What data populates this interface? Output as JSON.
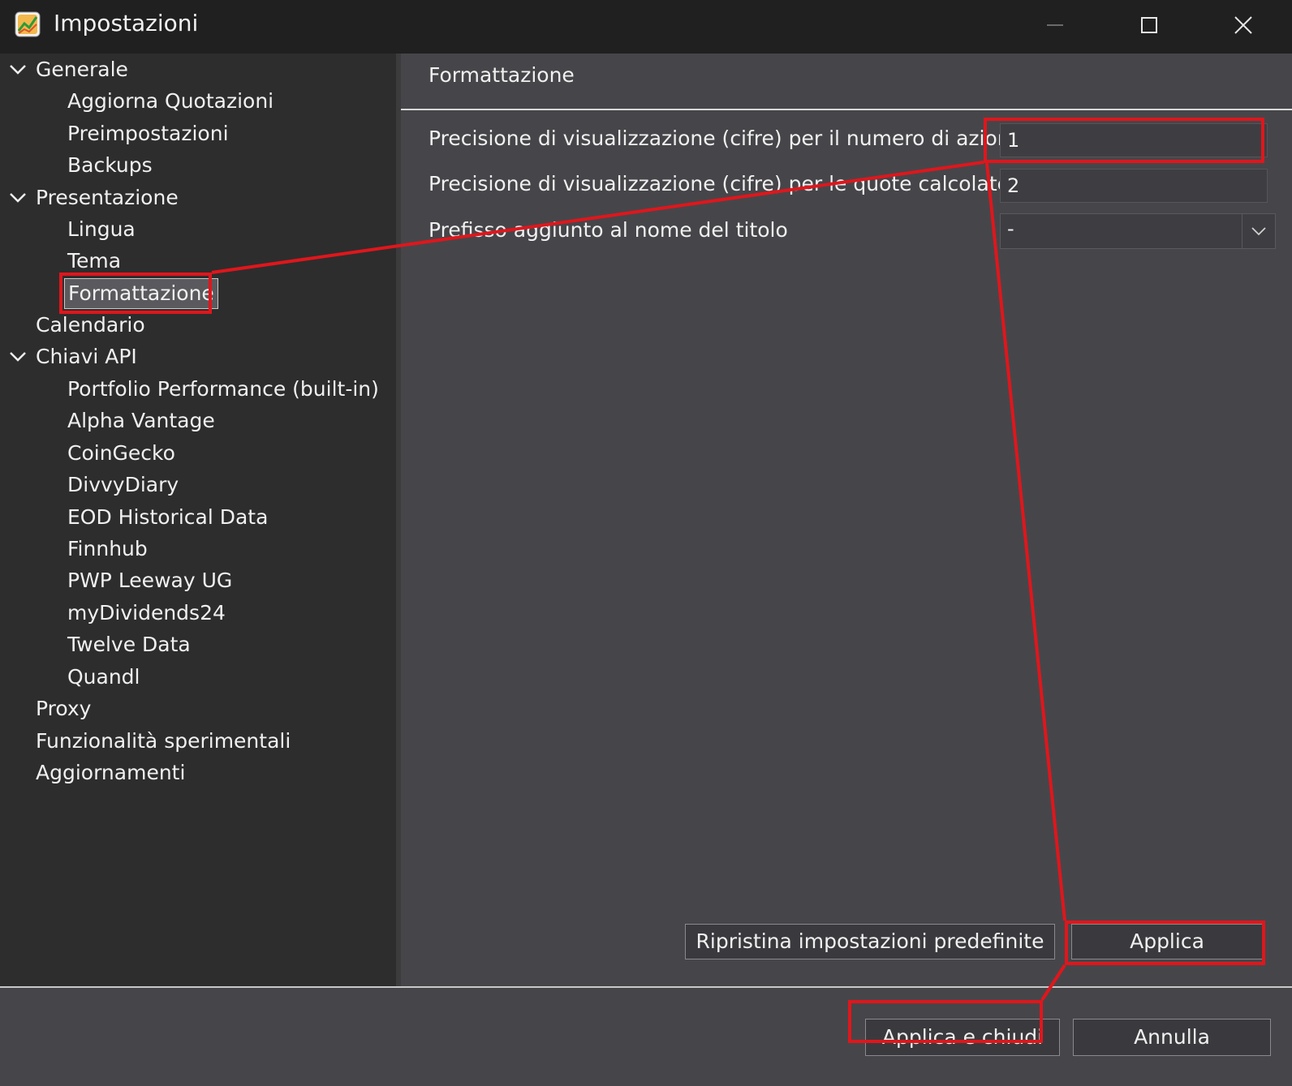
{
  "window": {
    "title": "Impostazioni",
    "icon": "chart-app-icon"
  },
  "sidebar": {
    "items": [
      {
        "label": "Generale",
        "level": 0,
        "expanded": true
      },
      {
        "label": "Aggiorna Quotazioni",
        "level": 1
      },
      {
        "label": "Preimpostazioni",
        "level": 1
      },
      {
        "label": "Backups",
        "level": 1
      },
      {
        "label": "Presentazione",
        "level": 0,
        "expanded": true
      },
      {
        "label": "Lingua",
        "level": 1
      },
      {
        "label": "Tema",
        "level": 1
      },
      {
        "label": "Formattazione",
        "level": 1,
        "selected": true
      },
      {
        "label": "Calendario",
        "level": 0
      },
      {
        "label": "Chiavi API",
        "level": 0,
        "expanded": true
      },
      {
        "label": "Portfolio Performance (built-in)",
        "level": 1
      },
      {
        "label": "Alpha Vantage",
        "level": 1
      },
      {
        "label": "CoinGecko",
        "level": 1
      },
      {
        "label": "DivvyDiary",
        "level": 1
      },
      {
        "label": "EOD Historical Data",
        "level": 1
      },
      {
        "label": "Finnhub",
        "level": 1
      },
      {
        "label": "PWP Leeway UG",
        "level": 1
      },
      {
        "label": "myDividends24",
        "level": 1
      },
      {
        "label": "Twelve Data",
        "level": 1
      },
      {
        "label": "Quandl",
        "level": 1
      },
      {
        "label": "Proxy",
        "level": 0
      },
      {
        "label": "Funzionalità sperimentali",
        "level": 0
      },
      {
        "label": "Aggiornamenti",
        "level": 0
      }
    ]
  },
  "content": {
    "title": "Formattazione",
    "fields": [
      {
        "label": "Precisione di visualizzazione (cifre) per il numero di azioni",
        "value": "1"
      },
      {
        "label": "Precisione di visualizzazione (cifre) per le quote calcolate",
        "value": "2"
      }
    ],
    "prefix": {
      "label": "Prefisso aggiunto al nome del titolo",
      "selected": "-"
    },
    "restore_label": "Ripristina impostazioni predefinite",
    "apply_label": "Applica"
  },
  "footer": {
    "apply_close_label": "Applica e chiudi",
    "cancel_label": "Annulla"
  },
  "annotation_color": "#e0161c"
}
